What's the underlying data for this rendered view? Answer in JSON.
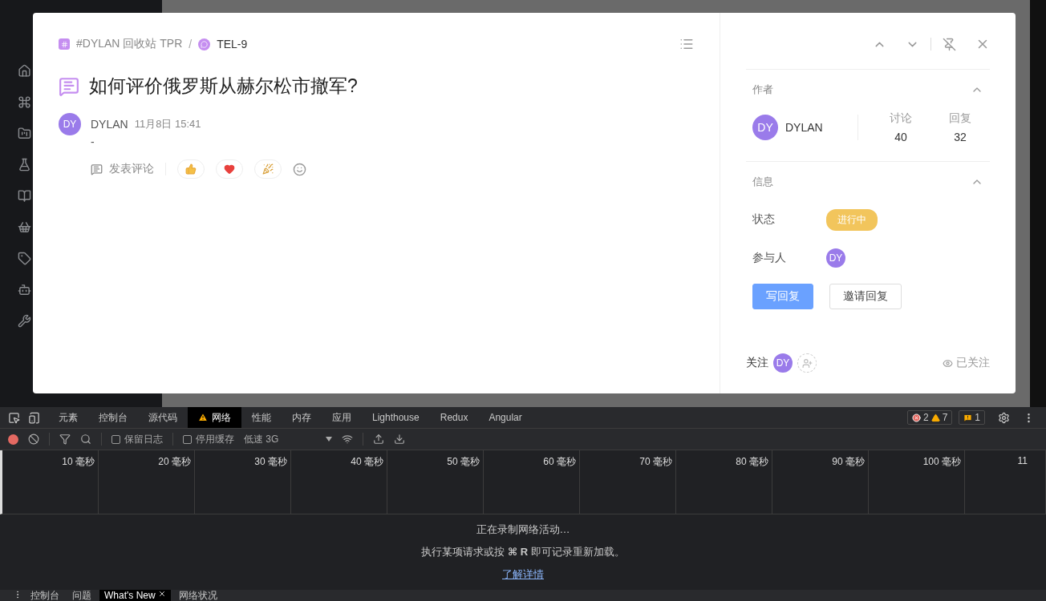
{
  "modal": {
    "breadcrumb": [
      {
        "kind": "channel",
        "label": "#DYLAN 回收站 TPR"
      },
      {
        "kind": "topic",
        "label": "TEL-9"
      }
    ],
    "separator": "/",
    "title": "如何评价俄罗斯从赫尔松市撤军?",
    "post": {
      "avatar": "DY",
      "author": "DYLAN",
      "time": "11月8日 15:41",
      "body": "-",
      "comment_action": "发表评论",
      "reactions": [
        {
          "kind": "thumbs"
        },
        {
          "kind": "heart"
        },
        {
          "kind": "party"
        }
      ]
    },
    "author_section": {
      "heading": "作者",
      "expanded": true,
      "avatar": "DY",
      "name": "DYLAN",
      "stats": [
        {
          "label": "讨论",
          "value": "40"
        },
        {
          "label": "回复",
          "value": "32"
        }
      ]
    },
    "info_section": {
      "heading": "信息",
      "expanded": true,
      "fields": [
        {
          "kind": "status",
          "label": "状态",
          "value": "进行中"
        },
        {
          "kind": "avatars",
          "label": "参与人",
          "avatars": [
            "DY"
          ]
        }
      ]
    },
    "buttons": [
      {
        "label": "写回复",
        "primary": true
      },
      {
        "label": "邀请回复",
        "primary": false
      }
    ],
    "follow": {
      "label": "关注",
      "avatars": [
        "DY"
      ],
      "status": "已关注"
    }
  },
  "devtools": {
    "tabs": [
      {
        "label": "元素",
        "selected": false,
        "warning": false
      },
      {
        "label": "控制台",
        "selected": false,
        "warning": false
      },
      {
        "label": "源代码",
        "selected": false,
        "warning": false
      },
      {
        "label": "网络",
        "selected": true,
        "warning": true
      },
      {
        "label": "性能",
        "selected": false,
        "warning": false
      },
      {
        "label": "内存",
        "selected": false,
        "warning": false
      },
      {
        "label": "应用",
        "selected": false,
        "warning": false
      },
      {
        "label": "Lighthouse",
        "selected": false,
        "warning": false
      },
      {
        "label": "Redux",
        "selected": false,
        "warning": false
      },
      {
        "label": "Angular",
        "selected": false,
        "warning": false
      }
    ],
    "errors": "2",
    "warnings": "7",
    "issues": "1",
    "checkboxes": [
      {
        "label": "保留日志",
        "checked": false
      },
      {
        "label": "停用缓存",
        "checked": false
      }
    ],
    "throttle": "低速 3G",
    "ticks": [
      "10 毫秒",
      "20 毫秒",
      "30 毫秒",
      "40 毫秒",
      "50 毫秒",
      "60 毫秒",
      "70 毫秒",
      "80 毫秒",
      "90 毫秒",
      "100 毫秒",
      "11"
    ],
    "messages": [
      "正在录制网络活动…",
      "执行某项请求或按 **⌘ R** 即可记录重新加载。"
    ],
    "link": "了解详情",
    "drawer_tabs": [
      {
        "label": "控制台",
        "selected": false,
        "closable": false
      },
      {
        "label": "问题",
        "selected": false,
        "closable": false
      },
      {
        "label": "What's New",
        "selected": true,
        "closable": true
      },
      {
        "label": "网络状况",
        "selected": false,
        "closable": false
      }
    ]
  }
}
